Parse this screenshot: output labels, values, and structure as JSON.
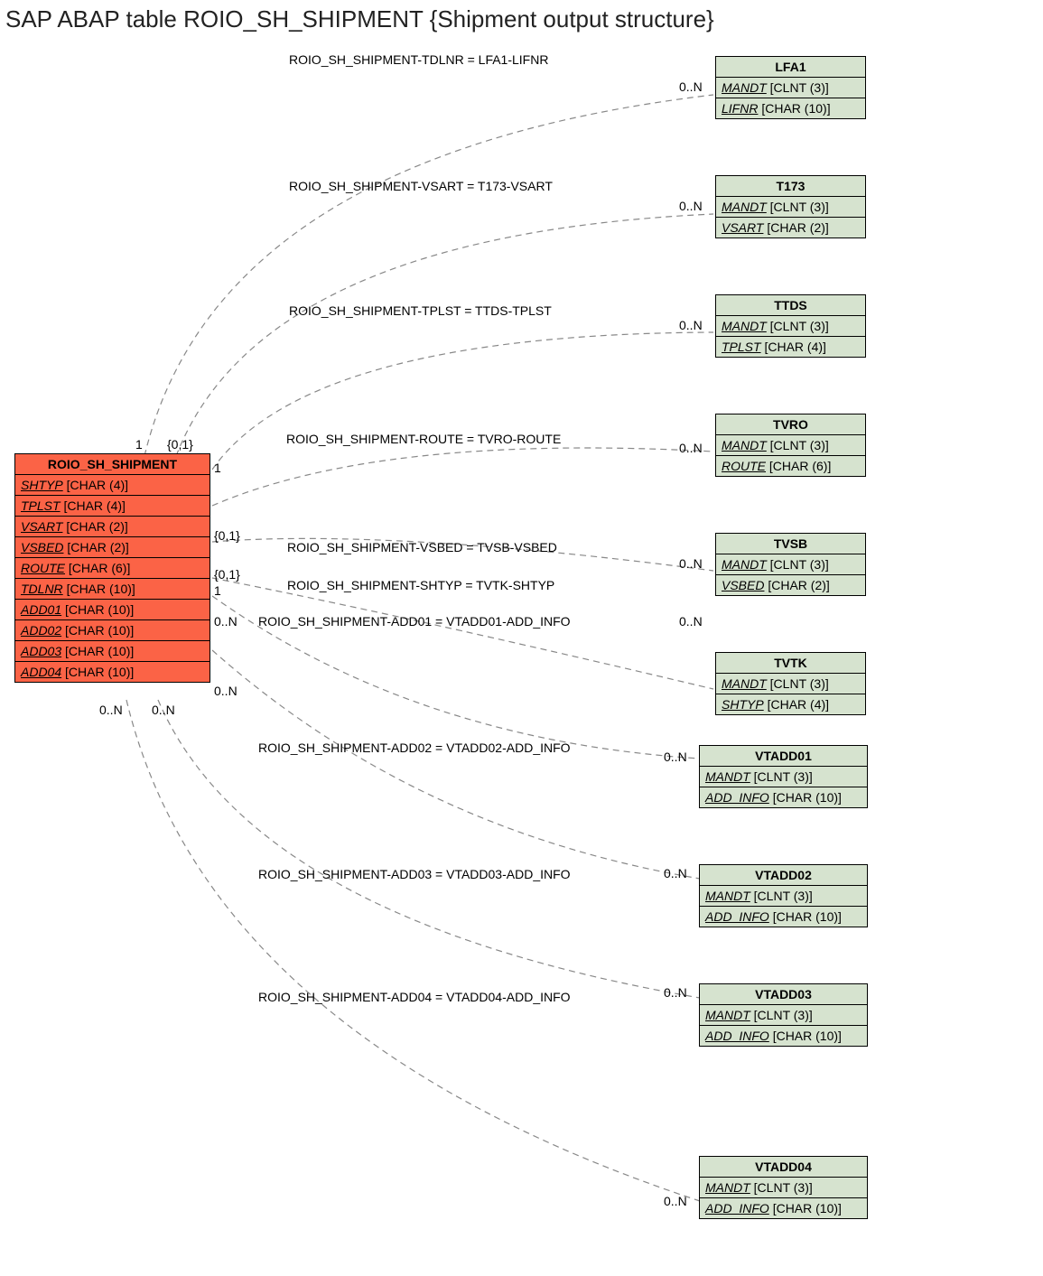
{
  "title": "SAP ABAP table ROIO_SH_SHIPMENT {Shipment output structure}",
  "source": {
    "name": "ROIO_SH_SHIPMENT",
    "fields": [
      {
        "name": "SHTYP",
        "type": "[CHAR (4)]"
      },
      {
        "name": "TPLST",
        "type": "[CHAR (4)]"
      },
      {
        "name": "VSART",
        "type": "[CHAR (2)]"
      },
      {
        "name": "VSBED",
        "type": "[CHAR (2)]"
      },
      {
        "name": "ROUTE",
        "type": "[CHAR (6)]"
      },
      {
        "name": "TDLNR",
        "type": "[CHAR (10)]"
      },
      {
        "name": "ADD01",
        "type": "[CHAR (10)]"
      },
      {
        "name": "ADD02",
        "type": "[CHAR (10)]"
      },
      {
        "name": "ADD03",
        "type": "[CHAR (10)]"
      },
      {
        "name": "ADD04",
        "type": "[CHAR (10)]"
      }
    ],
    "cards": {
      "c1": "1",
      "c2": "{0,1}",
      "c3": "1",
      "c4": "{0,1}",
      "c5": "{0,1}",
      "c6": "1",
      "c7": "0..N",
      "c8": "0..N",
      "c9": "0..N",
      "c10": "0..N"
    }
  },
  "targets": [
    {
      "name": "LFA1",
      "fields": [
        {
          "name": "MANDT",
          "type": "[CLNT (3)]"
        },
        {
          "name": "LIFNR",
          "type": "[CHAR (10)]"
        }
      ],
      "card": "0..N"
    },
    {
      "name": "T173",
      "fields": [
        {
          "name": "MANDT",
          "type": "[CLNT (3)]"
        },
        {
          "name": "VSART",
          "type": "[CHAR (2)]"
        }
      ],
      "card": "0..N"
    },
    {
      "name": "TTDS",
      "fields": [
        {
          "name": "MANDT",
          "type": "[CLNT (3)]"
        },
        {
          "name": "TPLST",
          "type": "[CHAR (4)]"
        }
      ],
      "card": "0..N"
    },
    {
      "name": "TVRO",
      "fields": [
        {
          "name": "MANDT",
          "type": "[CLNT (3)]"
        },
        {
          "name": "ROUTE",
          "type": "[CHAR (6)]"
        }
      ],
      "card": "0..N"
    },
    {
      "name": "TVSB",
      "fields": [
        {
          "name": "MANDT",
          "type": "[CLNT (3)]"
        },
        {
          "name": "VSBED",
          "type": "[CHAR (2)]"
        }
      ],
      "card": "0..N"
    },
    {
      "name": "TVTK",
      "fields": [
        {
          "name": "MANDT",
          "type": "[CLNT (3)]"
        },
        {
          "name": "SHTYP",
          "type": "[CHAR (4)]"
        }
      ],
      "card": "0..N"
    },
    {
      "name": "VTADD01",
      "fields": [
        {
          "name": "MANDT",
          "type": "[CLNT (3)]"
        },
        {
          "name": "ADD_INFO",
          "type": "[CHAR (10)]"
        }
      ],
      "card": "0..N"
    },
    {
      "name": "VTADD02",
      "fields": [
        {
          "name": "MANDT",
          "type": "[CLNT (3)]"
        },
        {
          "name": "ADD_INFO",
          "type": "[CHAR (10)]"
        }
      ],
      "card": "0..N"
    },
    {
      "name": "VTADD03",
      "fields": [
        {
          "name": "MANDT",
          "type": "[CLNT (3)]"
        },
        {
          "name": "ADD_INFO",
          "type": "[CHAR (10)]"
        }
      ],
      "card": "0..N"
    },
    {
      "name": "VTADD04",
      "fields": [
        {
          "name": "MANDT",
          "type": "[CLNT (3)]"
        },
        {
          "name": "ADD_INFO",
          "type": "[CHAR (10)]"
        }
      ],
      "card": "0..N"
    }
  ],
  "relations": [
    "ROIO_SH_SHIPMENT-TDLNR = LFA1-LIFNR",
    "ROIO_SH_SHIPMENT-VSART = T173-VSART",
    "ROIO_SH_SHIPMENT-TPLST = TTDS-TPLST",
    "ROIO_SH_SHIPMENT-ROUTE = TVRO-ROUTE",
    "ROIO_SH_SHIPMENT-VSBED = TVSB-VSBED",
    "ROIO_SH_SHIPMENT-SHTYP = TVTK-SHTYP",
    "ROIO_SH_SHIPMENT-ADD01 = VTADD01-ADD_INFO",
    "ROIO_SH_SHIPMENT-ADD02 = VTADD02-ADD_INFO",
    "ROIO_SH_SHIPMENT-ADD03 = VTADD03-ADD_INFO",
    "ROIO_SH_SHIPMENT-ADD04 = VTADD04-ADD_INFO"
  ]
}
